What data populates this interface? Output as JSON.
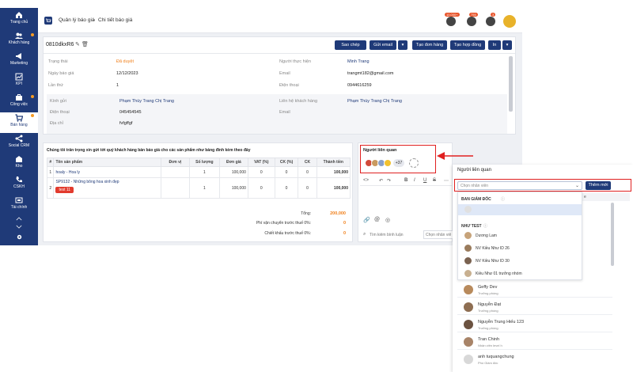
{
  "sidebar": {
    "items": [
      {
        "label": "Trang chủ",
        "icon": "home-icon"
      },
      {
        "label": "Khách hàng",
        "icon": "users-icon"
      },
      {
        "label": "Marketing",
        "icon": "megaphone-icon"
      },
      {
        "label": "KPI",
        "icon": "chart-icon"
      },
      {
        "label": "Công việc",
        "icon": "briefcase-icon"
      },
      {
        "label": "Bán hàng",
        "icon": "cart-icon"
      },
      {
        "label": "Social CRM",
        "icon": "share-icon"
      },
      {
        "label": "Kho",
        "icon": "warehouse-icon"
      },
      {
        "label": "CSKH",
        "icon": "phone-icon"
      },
      {
        "label": "Tài chính",
        "icon": "finance-icon"
      }
    ]
  },
  "header": {
    "breadcrumb_1": "Quản lý báo giá",
    "breadcrumb_sep": "›",
    "breadcrumb_2": "Chi tiết báo giá",
    "badge_1": "10,000+",
    "badge_2": "755",
    "badge_3": "3"
  },
  "quote": {
    "code": "0810dkxR6",
    "buttons": {
      "copy": "Sao chép",
      "email": "Gửi email",
      "order": "Tạo đơn hàng",
      "contract": "Tạo hợp đồng",
      "print": "In"
    },
    "labels": {
      "status": "Trạng thái",
      "date": "Ngày báo giá",
      "times": "Lần thứ",
      "owner": "Người thực hiện",
      "email": "Email",
      "phone": "Điện thoại",
      "dear": "Kính gửi",
      "cphone": "Điện thoại",
      "address": "Địa chỉ",
      "contact": "Liên hệ khách hàng",
      "cemail": "Email"
    },
    "values": {
      "status": "Đã duyệt",
      "date": "12/12/2023",
      "times": "1",
      "owner": "Minh Trang",
      "email": "trangmt182@gmail.com",
      "phone": "0944616259",
      "dear": "Phạm Thùy Trang Chị Trang",
      "cphone": "045454545",
      "address": "fvfgffgf",
      "contact": "Phạm Thùy Trang Chị Trang"
    }
  },
  "products": {
    "intro": "Chúng tôi trân trọng xin gửi tới quý khách hàng bản báo giá cho các sản phẩm như bảng đính kèm theo đây",
    "headers": [
      "#",
      "Tên sản phẩm",
      "Đơn vị",
      "Số lượng",
      "Đơn giá",
      "VAT (%)",
      "CK (%)",
      "CK",
      "Thành tiền"
    ],
    "rows": [
      {
        "no": "1",
        "name": "hoaly - Hoa ly",
        "unit": "",
        "qty": "1",
        "price": "100,000",
        "vat": "0",
        "ckp": "0",
        "ck": "0",
        "total": "100,000",
        "tag": ""
      },
      {
        "no": "2",
        "name": "SP9132 - Những bông hoa xinh đẹp",
        "unit": "",
        "qty": "1",
        "price": "100,000",
        "vat": "0",
        "ckp": "0",
        "ck": "0",
        "total": "100,000",
        "tag": "test 11"
      }
    ],
    "sum_label": "Tổng:",
    "sum_value": "200,000",
    "ship_label": "Phí vận chuyển trước thuế 0%:",
    "ship_value": "0",
    "disc_label": "Chiết khấu trước thuế 0%:",
    "disc_value": "0"
  },
  "related": {
    "title": "Người liên quan",
    "more": "+37",
    "search_placeholder": "Tìm kiếm bình luận",
    "choose_placeholder": "Chọn nhân viê"
  },
  "popup": {
    "title": "Người liên quan",
    "select_placeholder": "Chọn nhân viên",
    "add_button": "Thêm mới",
    "group_1": "BAN GIÁM ĐỐC",
    "group_2": "NHƯ TEST",
    "dropdown_items": [
      "Dương Lam",
      "NV Kiều Như ID 26",
      "NV Kiều Như ID 30",
      "Kiều Như 01 trưởng nhóm"
    ],
    "people": [
      {
        "name": "Geffy Dev",
        "role": "Trưởng phòng"
      },
      {
        "name": "Nguyễn Đạt",
        "role": "Trưởng phòng"
      },
      {
        "name": "Nguyễn Trung Hiếu 123",
        "role": "Trưởng phòng"
      },
      {
        "name": "Tran Chinh",
        "role": "Nhân viên level h"
      },
      {
        "name": "anh tuquangchung",
        "role": "Phó Giám đốc"
      }
    ],
    "col_hint": "e"
  },
  "colors": {
    "brand": "#1f3a78",
    "accent_red": "#e02020",
    "orange": "#f07f1a"
  }
}
